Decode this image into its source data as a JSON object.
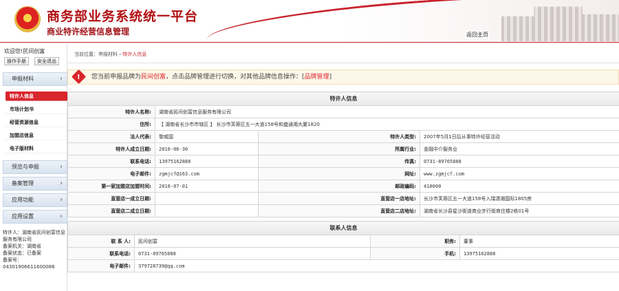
{
  "header": {
    "title": "商务部业务系统统一平台",
    "subtitle": "商业特许经营信息管理",
    "home_link": "返回主页"
  },
  "sidebar": {
    "welcome": "欢迎您!民间创富",
    "buttons": [
      "操作手册",
      "安全退出"
    ],
    "main_menu": [
      {
        "label": "申报材料"
      },
      {
        "label": "预览与申报"
      },
      {
        "label": "备案管理"
      },
      {
        "label": "应用功能"
      },
      {
        "label": "应用设置"
      }
    ],
    "sub_menu": [
      "特许人信息",
      "市场计划书",
      "经营资源信息",
      "加盟店信息",
      "电子版材料"
    ],
    "active_sub": "特许人信息",
    "info_lines": [
      "特许人：湖南省民间创富信息",
      "服务有限公司",
      "备案机关：湖南省",
      "备案状态：已备案",
      "备案号：04301906611600086"
    ]
  },
  "breadcrumb": {
    "prefix": "当前位置：",
    "parent": "申报材料",
    "separator": "›",
    "current": "特许人信息"
  },
  "notice": {
    "text_before": "您当前申报品牌为",
    "brand": "民间创富",
    "text_after": "，点击品牌管理进行切换，对其他品牌信息操作：[",
    "link": "品牌管理",
    "text_end": "]"
  },
  "franchisor": {
    "section_title": "特许人信息",
    "name_label": "特许人名称:",
    "name_value": "湖南省民间创富信息服务有限公司",
    "address_label": "住所:",
    "address_value": "【 湖南省长沙市市辖区 】 长沙市芙蓉区五一大道158号和盛通湘大厦1820",
    "legal_rep_label": "法人代表:",
    "legal_rep_value": "黎威国",
    "type_label": "特许人类型:",
    "type_value": "2007年5月1日后从事特许经营活动",
    "founded_label": "特许人成立日期:",
    "founded_value": "2016-06-30",
    "industry_label": "所属行业:",
    "industry_value": "金融中介服务业",
    "phone_label": "联系电话:",
    "phone_value": "13975162888",
    "fax_label": "传真:",
    "fax_value": "0731-89765888",
    "email_label": "电子邮件:",
    "email_value": "zgmjcf@163.com",
    "website_label": "网址:",
    "website_value": "www.zgmjcf.com",
    "first_store_label": "第一家加盟店加盟时间:",
    "first_store_value": "2016-07-01",
    "postcode_label": "邮政编码:",
    "postcode_value": "410000",
    "store1_date_label": "直营店一成立日期:",
    "store1_date_value": "",
    "store1_addr_label": "直营店一店地址:",
    "store1_addr_value": "长沙市芙蓉区五一大道158号入瑞潇湘国际1805房",
    "store2_date_label": "直营店二成立日期:",
    "store2_date_value": "",
    "store2_addr_label": "直营店二店地址:",
    "store2_addr_value": "湖南省长沙县星沙街道商业步行街商住楼2栋01号"
  },
  "contact": {
    "section_title": "联系人信息",
    "person_label": "联 系 人:",
    "person_value": "民间创富",
    "position_label": "职务:",
    "position_value": "董事",
    "phone_label": "联系电话:",
    "phone_value": "0731-89765888",
    "mobile_label": "手机:",
    "mobile_value": "13975162888",
    "email_label": "电子邮件:",
    "email_value": "379728739@qq.com"
  },
  "colors": {
    "brand_red": "#c8232b",
    "active_red": "#d9262d",
    "notice_bg": "#fdf7e9"
  },
  "icons": [
    "national-emblem-icon",
    "warning-icon",
    "chevron-right-icon"
  ]
}
